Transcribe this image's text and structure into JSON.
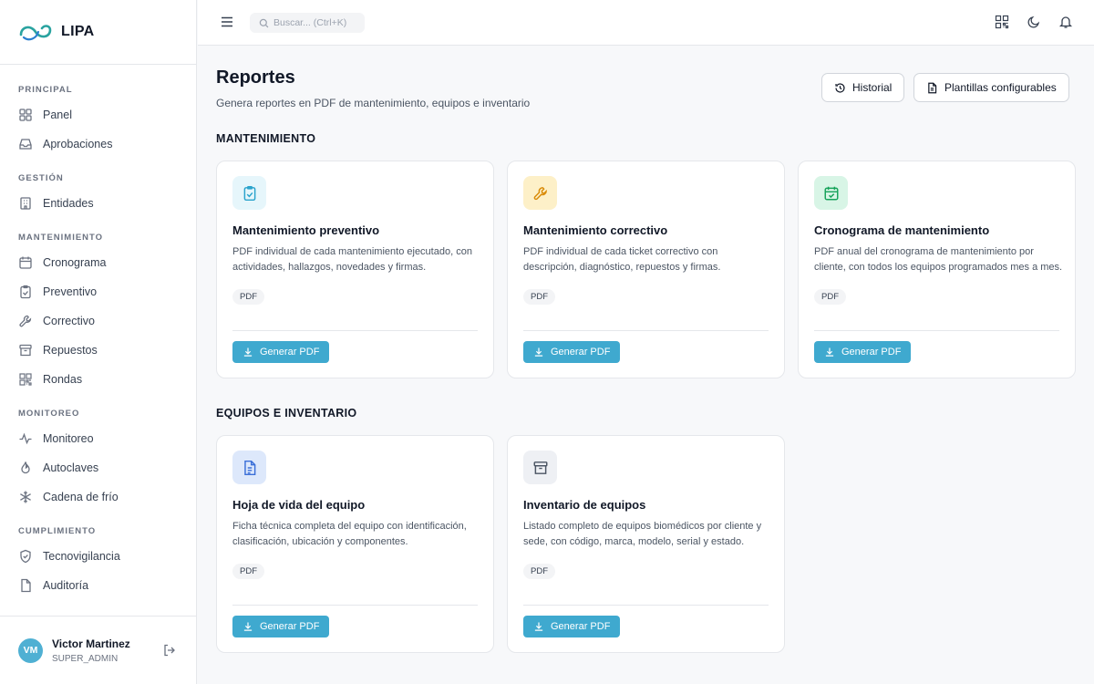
{
  "app": {
    "name": "LIPA"
  },
  "sidebar": {
    "sections": [
      {
        "heading": "PRINCIPAL",
        "items": [
          {
            "label": "Panel",
            "icon": "grid-icon"
          },
          {
            "label": "Aprobaciones",
            "icon": "inbox-icon"
          }
        ]
      },
      {
        "heading": "GESTIÓN",
        "items": [
          {
            "label": "Entidades",
            "icon": "building-icon"
          }
        ]
      },
      {
        "heading": "MANTENIMIENTO",
        "items": [
          {
            "label": "Cronograma",
            "icon": "calendar-icon"
          },
          {
            "label": "Preventivo",
            "icon": "clipboard-check-icon"
          },
          {
            "label": "Correctivo",
            "icon": "wrench-icon"
          },
          {
            "label": "Repuestos",
            "icon": "archive-icon"
          },
          {
            "label": "Rondas",
            "icon": "qr-icon"
          }
        ]
      },
      {
        "heading": "MONITOREO",
        "items": [
          {
            "label": "Monitoreo",
            "icon": "activity-icon"
          },
          {
            "label": "Autoclaves",
            "icon": "flame-icon"
          },
          {
            "label": "Cadena de frío",
            "icon": "snowflake-icon"
          }
        ]
      },
      {
        "heading": "CUMPLIMIENTO",
        "items": [
          {
            "label": "Tecnovigilancia",
            "icon": "shield-icon"
          },
          {
            "label": "Auditoría",
            "icon": "file-icon"
          }
        ]
      }
    ]
  },
  "user": {
    "initials": "VM",
    "name": "Victor Martinez",
    "role": "SUPER_ADMIN"
  },
  "topbar": {
    "search_placeholder": "Buscar... (Ctrl+K)"
  },
  "page": {
    "title": "Reportes",
    "subtitle": "Genera reportes en PDF de mantenimiento, equipos e inventario",
    "history_label": "Historial",
    "templates_label": "Plantillas configurables"
  },
  "sections": [
    {
      "title": "MANTENIMIENTO",
      "cards": [
        {
          "title": "Mantenimiento preventivo",
          "description": "PDF individual de cada mantenimiento ejecutado, con actividades, hallazgos, novedades y firmas.",
          "badge": "PDF",
          "button": "Generar PDF",
          "icon": "clipboard-check-icon",
          "icon_bg": "#e6f6fb",
          "icon_color": "#2aa3cc"
        },
        {
          "title": "Mantenimiento correctivo",
          "description": "PDF individual de cada ticket correctivo con descripción, diagnóstico, repuestos y firmas.",
          "badge": "PDF",
          "button": "Generar PDF",
          "icon": "wrench-icon",
          "icon_bg": "#fdf0c8",
          "icon_color": "#d98a06"
        },
        {
          "title": "Cronograma de mantenimiento",
          "description": "PDF anual del cronograma de mantenimiento por cliente, con todos los equipos programados mes a mes.",
          "badge": "PDF",
          "button": "Generar PDF",
          "icon": "calendar-check-icon",
          "icon_bg": "#d8f5e6",
          "icon_color": "#16a35a"
        }
      ]
    },
    {
      "title": "EQUIPOS E INVENTARIO",
      "cards": [
        {
          "title": "Hoja de vida del equipo",
          "description": "Ficha técnica completa del equipo con identificación, clasificación, ubicación y componentes.",
          "badge": "PDF",
          "button": "Generar PDF",
          "icon": "file-text-icon",
          "icon_bg": "#dde8fb",
          "icon_color": "#3b6fd8"
        },
        {
          "title": "Inventario de equipos",
          "description": "Listado completo de equipos biomédicos por cliente y sede, con código, marca, modelo, serial y estado.",
          "badge": "PDF",
          "button": "Generar PDF",
          "icon": "archive-icon",
          "icon_bg": "#eef0f4",
          "icon_color": "#4b5563"
        }
      ]
    }
  ],
  "colors": {
    "accent": "#3fa9cf",
    "avatar": "#4fb0d3",
    "brand_teal": "#2aa3a0"
  }
}
